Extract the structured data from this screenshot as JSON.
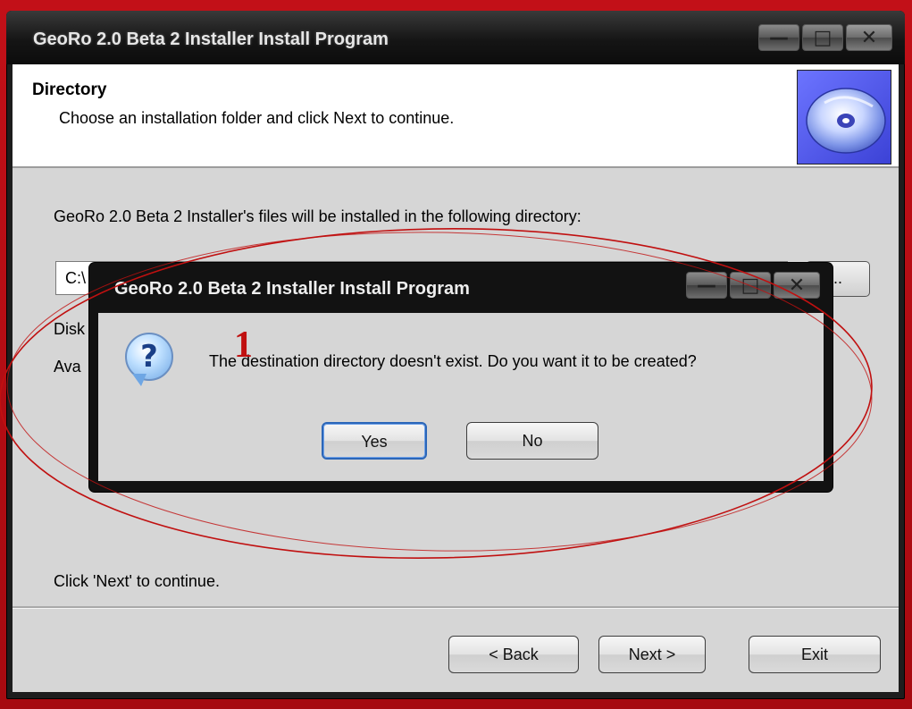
{
  "window": {
    "title": "GeoRo 2.0 Beta 2 Installer Install Program",
    "minimize_glyph": "—",
    "maximize_glyph": "□",
    "close_glyph": "✕"
  },
  "header": {
    "title": "Directory",
    "subtitle": "Choose an installation folder and click Next to continue.",
    "image_icon": "cd-disc-icon"
  },
  "body": {
    "directory_text": "GeoRo 2.0 Beta 2 Installer's files will be installed in the following directory:",
    "path_value": "C:\\",
    "browse_label": "..",
    "disk_label": "Disk",
    "available_label": "Ava",
    "next_hint": "Click 'Next' to continue."
  },
  "buttons": {
    "back": "< Back",
    "next": "Next >",
    "exit": "Exit"
  },
  "dialog": {
    "title": "GeoRo 2.0 Beta 2 Installer Install Program",
    "icon": "question-icon",
    "icon_glyph": "?",
    "message": "The destination directory doesn't exist. Do you want it to be created?",
    "yes": "Yes",
    "no": "No"
  },
  "annotation": {
    "marker": "1",
    "color": "#c01010"
  }
}
